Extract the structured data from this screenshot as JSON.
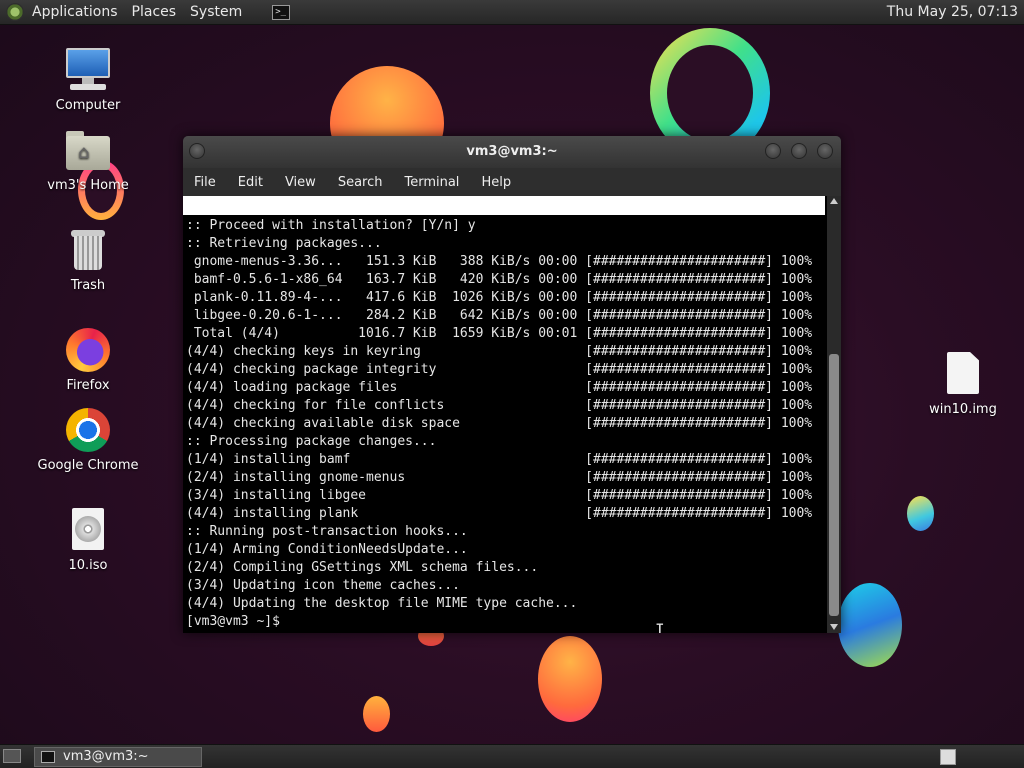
{
  "top_panel": {
    "menus": [
      "Applications",
      "Places",
      "System"
    ],
    "clock": "Thu May 25, 07:13"
  },
  "desktop_icons": [
    {
      "label": "Computer",
      "icon": "computer-icon"
    },
    {
      "label": "vm3's Home",
      "icon": "home-folder-icon"
    },
    {
      "label": "Trash",
      "icon": "trash-icon"
    },
    {
      "label": "Firefox",
      "icon": "firefox-icon"
    },
    {
      "label": "Google Chrome",
      "icon": "chrome-icon"
    },
    {
      "label": "10.iso",
      "icon": "disc-image-icon"
    },
    {
      "label": "win10.img",
      "icon": "file-icon"
    }
  ],
  "terminal": {
    "title": "vm3@vm3:~",
    "menu": [
      "File",
      "Edit",
      "View",
      "Search",
      "Terminal",
      "Help"
    ],
    "output": ":: Proceed with installation? [Y/n] y\n:: Retrieving packages...\n gnome-menus-3.36...   151.3 KiB   388 KiB/s 00:00 [######################] 100%\n bamf-0.5.6-1-x86_64   163.7 KiB   420 KiB/s 00:00 [######################] 100%\n plank-0.11.89-4-...   417.6 KiB  1026 KiB/s 00:00 [######################] 100%\n libgee-0.20.6-1-...   284.2 KiB   642 KiB/s 00:00 [######################] 100%\n Total (4/4)          1016.7 KiB  1659 KiB/s 00:01 [######################] 100%\n(4/4) checking keys in keyring                     [######################] 100%\n(4/4) checking package integrity                   [######################] 100%\n(4/4) loading package files                        [######################] 100%\n(4/4) checking for file conflicts                  [######################] 100%\n(4/4) checking available disk space                [######################] 100%\n:: Processing package changes...\n(1/4) installing bamf                              [######################] 100%\n(2/4) installing gnome-menus                       [######################] 100%\n(3/4) installing libgee                            [######################] 100%\n(4/4) installing plank                             [######################] 100%\n:: Running post-transaction hooks...\n(1/4) Arming ConditionNeedsUpdate...\n(2/4) Compiling GSettings XML schema files...\n(3/4) Updating icon theme caches...\n(4/4) Updating the desktop file MIME type cache...\n[vm3@vm3 ~]$"
  },
  "taskbar": {
    "window_button": "vm3@vm3:~"
  }
}
